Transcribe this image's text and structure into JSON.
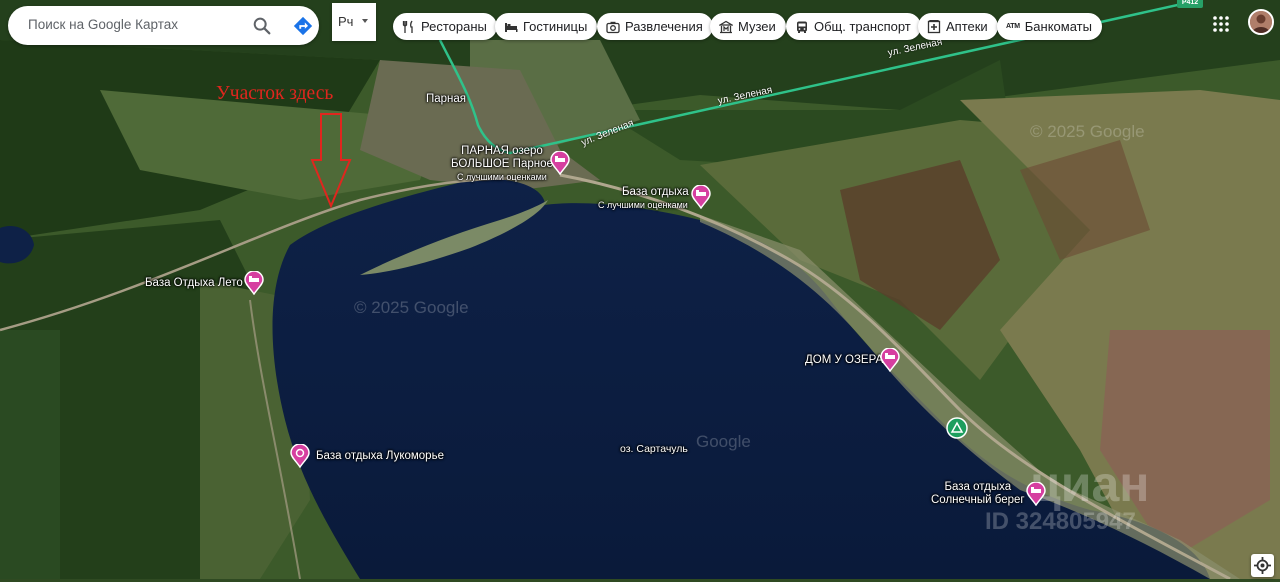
{
  "search": {
    "placeholder": "Поиск на Google Картах"
  },
  "language": {
    "label": "Рч"
  },
  "categories": [
    {
      "label": "Рестораны",
      "icon": "fork-knife-icon"
    },
    {
      "label": "Гостиницы",
      "icon": "bed-icon"
    },
    {
      "label": "Развлечения",
      "icon": "camera-icon"
    },
    {
      "label": "Музеи",
      "icon": "museum-icon"
    },
    {
      "label": "Общ. транспорт",
      "icon": "bus-icon"
    },
    {
      "label": "Аптеки",
      "icon": "pharmacy-icon"
    },
    {
      "label": "Банкоматы",
      "icon": "atm-icon",
      "badge": "ATM"
    }
  ],
  "annotation": {
    "text": "Участок здесь"
  },
  "places": {
    "parnaya": "Парная",
    "lake_label_1": "ПАРНАЯ озеро",
    "lake_label_2": "БОЛЬШОЕ Парное",
    "lake_rating": "С лучшими оценками",
    "base_otdykha": "База отдыха",
    "base_rating": "С лучшими оценками",
    "base_leto": "База Отдыха Лето",
    "dom_u_ozera": "ДОМ У ОЗЕРА",
    "lukomorye": "База отдыха Лукоморье",
    "lake_name": "оз. Сартачуль",
    "solnechny_1": "База отдыха",
    "solnechny_2": "Солнечный берег"
  },
  "roads": {
    "zelenaya_1": "ул. Зеленая",
    "zelenaya_2": "ул. Зеленая",
    "zelenaya_3": "ул. Зеленая",
    "route_shield": "Р412"
  },
  "watermarks": {
    "google_1": "© 2025 Google",
    "google_2": "© 2025 Google",
    "google_3": "Google",
    "listing_id": "ID 324805947",
    "brand": "циан"
  },
  "colors": {
    "hotel_pin": "#d63fa0",
    "road_green": "#2fc28a",
    "annotation_red": "#e0261e",
    "water": "#0c1d3f"
  }
}
